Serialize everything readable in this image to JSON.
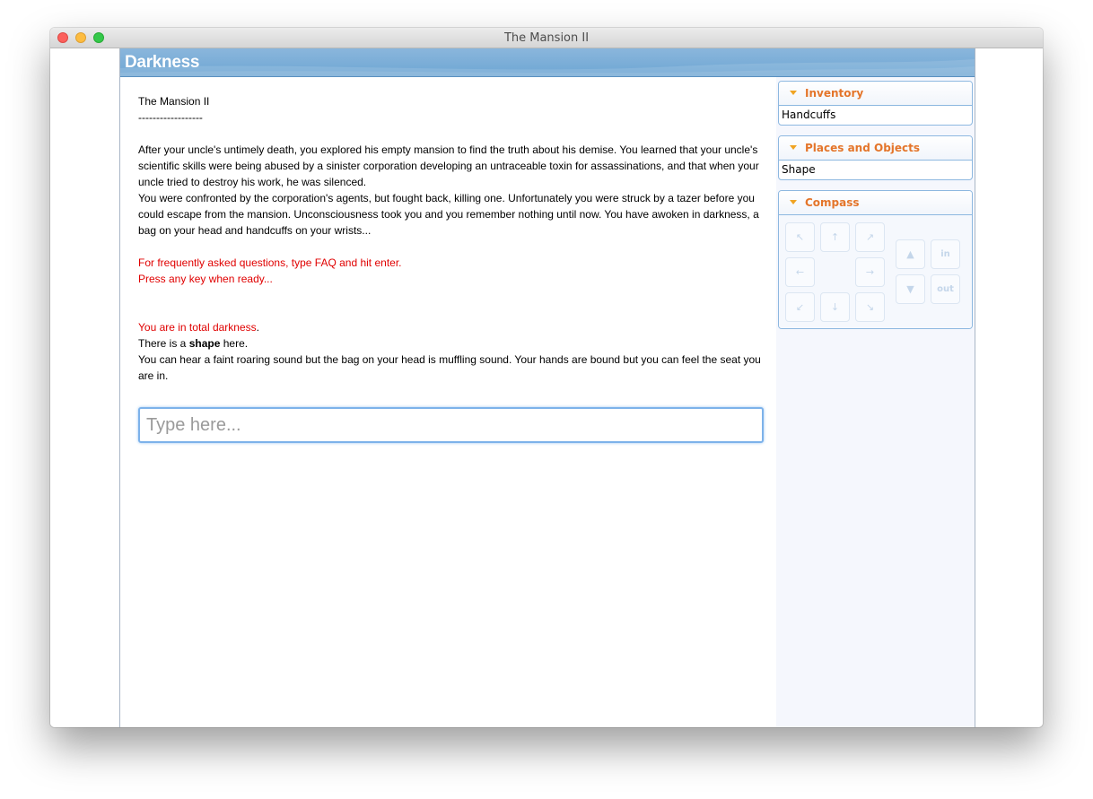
{
  "window": {
    "title": "The Mansion II"
  },
  "banner": {
    "title": "Darkness"
  },
  "main": {
    "header": "The Mansion II",
    "divider": "------------------",
    "intro_1": "After your uncle's untimely death, you explored his empty mansion to find the truth about his demise. You learned that your uncle's scientific skills were being abused by a sinister corporation developing an untraceable toxin for assassinations, and that when your uncle tried to destroy his work, he was silenced.",
    "intro_2": "You were confronted by the corporation's agents, but fought back, killing one. Unfortunately you were struck by a tazer before you could escape from the mansion. Unconsciousness took you and you remember nothing until now. You have awoken in darkness, a bag on your head and handcuffs on your wrists...",
    "faq_hint": "For frequently asked questions, type FAQ and hit enter.",
    "press_key": "Press any key when ready...",
    "location_line": "You are in total darkness",
    "location_period": ".",
    "object_prefix": "There is a ",
    "object_name": "shape",
    "object_suffix": " here.",
    "description": "You can hear a faint roaring sound but the bag on your head is muffling sound. Your hands are bound but you can feel the seat you are in."
  },
  "input": {
    "placeholder": "Type here..."
  },
  "sidebar": {
    "inventory": {
      "title": "Inventory",
      "items": [
        "Handcuffs"
      ]
    },
    "places": {
      "title": "Places and Objects",
      "items": [
        "Shape"
      ]
    },
    "compass": {
      "title": "Compass",
      "buttons": {
        "nw": "↖",
        "n": "↑",
        "ne": "↗",
        "w": "←",
        "e": "→",
        "sw": "↙",
        "s": "↓",
        "se": "↘",
        "up": "▲",
        "down": "▼",
        "in": "in",
        "out": "out"
      }
    }
  },
  "colors": {
    "banner": "#6ea6d3",
    "panel_title": "#e4752a",
    "panel_arrow": "#f0a422",
    "alert_text": "#e00000",
    "input_focus": "#7db2ea"
  }
}
